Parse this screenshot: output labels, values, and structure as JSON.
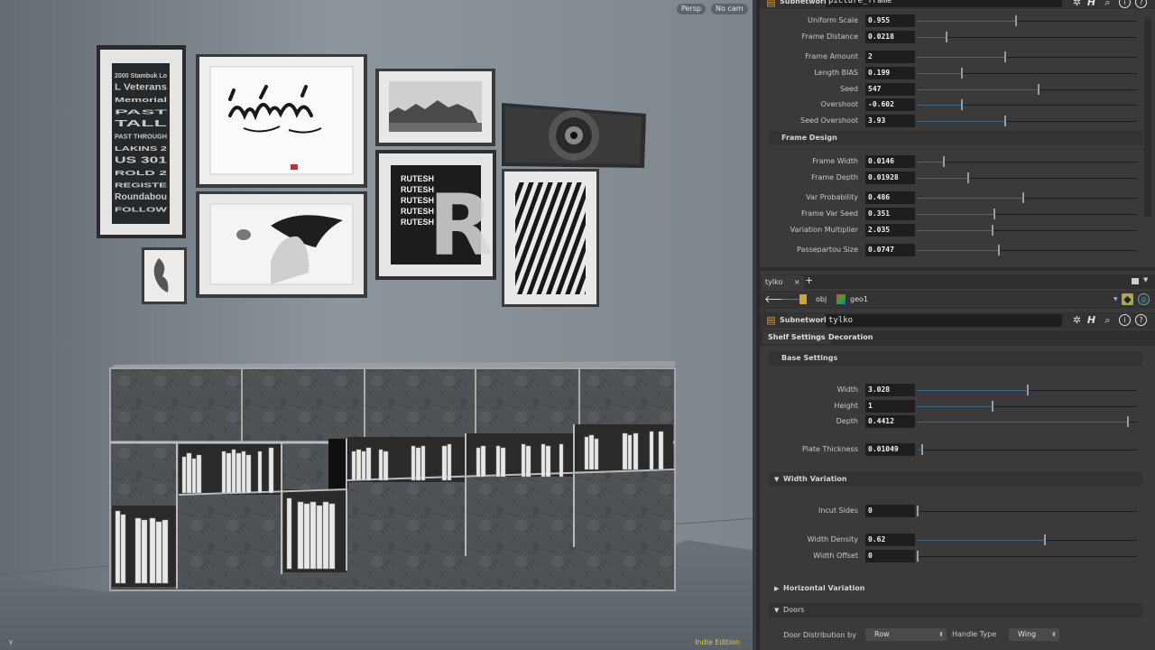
{
  "viewport": {
    "persp_label": "Persp",
    "cam_label": "No cam",
    "edition": "Indie Edition",
    "axis_label": "y",
    "art": {
      "typography_poster_lines": [
        "2000 Stambuk Lo",
        "L Veterans",
        "Memorial",
        "PAST",
        "TALL",
        "PAST THROUGH",
        "LAKINS 2",
        "US 301",
        "ROLD 2",
        "REGISTE",
        "Roundabou",
        "FOLLOW"
      ],
      "rutesh_words": [
        "RUTESH",
        "RUTESH",
        "RUTESH",
        "RUTESH",
        "RUTESH"
      ],
      "rutesh_letter": "R"
    }
  },
  "top_node": {
    "type": "Subnetwork",
    "name": "picture_frame",
    "params": [
      {
        "label": "Uniform Scale",
        "value": "0.955",
        "fill": 0.45
      },
      {
        "label": "Frame Distance",
        "value": "0.0218",
        "fill": 0.13
      },
      {
        "label": "Frame Amount",
        "value": "2",
        "fill": 0.4
      },
      {
        "label": "Length BIAS",
        "value": "0.199",
        "fill": 0.2
      },
      {
        "label": "Seed",
        "value": "547",
        "fill": 0.55
      },
      {
        "label": "Overshoot",
        "value": "-0.602",
        "fill": 0.2
      },
      {
        "label": "Seed Overshoot",
        "value": "3.93",
        "fill": 0.4
      }
    ],
    "section_title": "Frame Design",
    "design_params": [
      {
        "label": "Frame Width",
        "value": "0.0146",
        "fill": 0.12
      },
      {
        "label": "Frame Depth",
        "value": "0.01928",
        "fill": 0.23
      },
      {
        "label": "Var Probability",
        "value": "0.486",
        "fill": 0.48
      },
      {
        "label": "Frame Var Seed",
        "value": "0.351",
        "fill": 0.35
      },
      {
        "label": "Variation Multiplier",
        "value": "2.035",
        "fill": 0.34
      },
      {
        "label": "Passepartou Size",
        "value": "0.0747",
        "fill": 0.37
      }
    ]
  },
  "pane_tab": {
    "label": "tylko",
    "close": "×",
    "add": "+"
  },
  "path": {
    "root": "obj",
    "node": "geo1"
  },
  "node": {
    "type": "Subnetwork",
    "name": "tylko",
    "tabs": [
      "Shelf Settings",
      "Decoration"
    ],
    "base_section": "Base Settings",
    "base_params": [
      {
        "label": "Width",
        "value": "3.028",
        "fill": 0.5
      },
      {
        "label": "Height",
        "value": "1",
        "fill": 0.34
      },
      {
        "label": "Depth",
        "value": "0.4412",
        "fill": 0.96
      }
    ],
    "plate_param": {
      "label": "Plate Thickness",
      "value": "0.01049",
      "fill": 0.02
    },
    "width_variation": {
      "title": "Width Variation",
      "params": [
        {
          "label": "Incut Sides",
          "value": "0",
          "fill": 0.0
        },
        {
          "label": "Width Density",
          "value": "0.62",
          "fill": 0.58
        },
        {
          "label": "Width Offset",
          "value": "0",
          "fill": 0.0
        }
      ]
    },
    "horizontal_variation": {
      "title": "Horizontal Variation"
    },
    "doors": {
      "title": "Doors",
      "distribution_label": "Door Distribution by",
      "distribution_value": "Row",
      "handle_label": "Handle Type",
      "handle_value": "Wing"
    }
  },
  "colors": {
    "slider_fill": "#3b6a8e",
    "edition_text": "#e6d21c"
  }
}
